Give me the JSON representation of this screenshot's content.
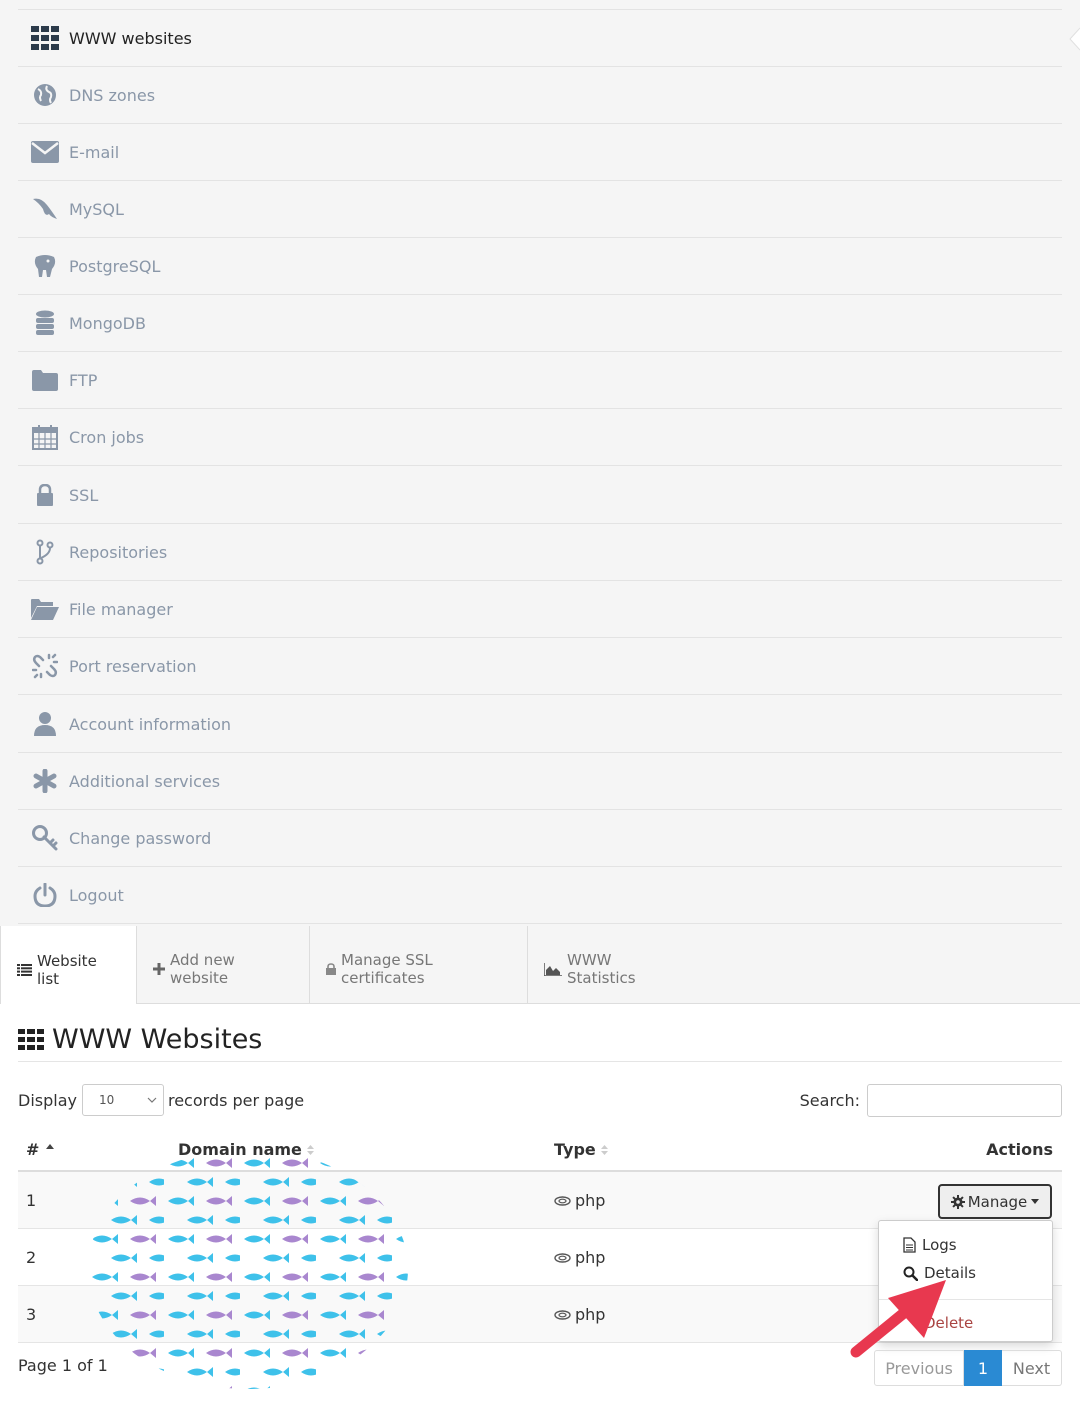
{
  "menu": {
    "items": [
      {
        "label": "WWW websites",
        "icon": "grid-icon",
        "active": true
      },
      {
        "label": "DNS zones",
        "icon": "globe-icon"
      },
      {
        "label": "E-mail",
        "icon": "envelope-icon"
      },
      {
        "label": "MySQL",
        "icon": "dolphin-icon"
      },
      {
        "label": "PostgreSQL",
        "icon": "elephant-icon"
      },
      {
        "label": "MongoDB",
        "icon": "database-icon"
      },
      {
        "label": "FTP",
        "icon": "folder-icon"
      },
      {
        "label": "Cron jobs",
        "icon": "calendar-icon"
      },
      {
        "label": "SSL",
        "icon": "lock-icon"
      },
      {
        "label": "Repositories",
        "icon": "branch-icon"
      },
      {
        "label": "File manager",
        "icon": "folder-open-icon"
      },
      {
        "label": "Port reservation",
        "icon": "broken-link-icon"
      },
      {
        "label": "Account information",
        "icon": "user-icon"
      },
      {
        "label": "Additional services",
        "icon": "asterisk-icon"
      },
      {
        "label": "Change password",
        "icon": "key-icon"
      },
      {
        "label": "Logout",
        "icon": "power-icon"
      }
    ]
  },
  "tabs": [
    {
      "label": "Website list",
      "icon": "list-icon",
      "active": true
    },
    {
      "label": "Add new website",
      "icon": "plus-icon"
    },
    {
      "label": "Manage SSL certificates",
      "icon": "lock-icon"
    },
    {
      "label": "WWW Statistics",
      "icon": "area-chart-icon"
    }
  ],
  "main": {
    "title": "WWW Websites",
    "display_label": "Display",
    "records_label": "records per page",
    "page_size": "10",
    "search_label": "Search:",
    "search_value": "",
    "columns": {
      "num": "#",
      "domain": "Domain name",
      "type": "Type",
      "actions": "Actions"
    },
    "rows": [
      {
        "num": "1",
        "type": "php"
      },
      {
        "num": "2",
        "type": "php"
      },
      {
        "num": "3",
        "type": "php"
      }
    ],
    "manage_label": "Manage",
    "dropdown": {
      "logs": "Logs",
      "details": "Details",
      "delete": "Delete"
    },
    "pager": {
      "text": "Page 1 of 1",
      "previous": "Previous",
      "current": "1",
      "next": "Next"
    }
  },
  "colors": {
    "accent": "#2a8ad3",
    "menu_icon": "#8a97a8",
    "delete": "#a94442",
    "arrow": "#e8384f"
  }
}
